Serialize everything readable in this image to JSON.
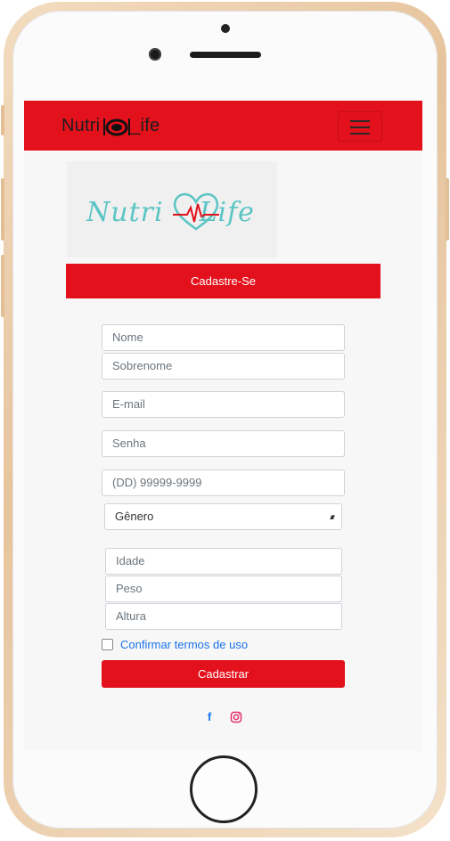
{
  "navbar": {
    "brand_left": "Nutri",
    "brand_right": "_ife",
    "menu_icon": "hamburger-icon",
    "color": "#e3111c"
  },
  "logo": {
    "part1": "Nutri",
    "part2": "Life",
    "color": "#5bc5c4"
  },
  "page_title": "Cadastre-Se",
  "form": {
    "nome_placeholder": "Nome",
    "sobrenome_placeholder": "Sobrenome",
    "email_placeholder": "E-mail",
    "senha_placeholder": "Senha",
    "telefone_placeholder": "(DD) 99999-9999",
    "genero_selected": "Gênero",
    "idade_placeholder": "Idade",
    "peso_placeholder": "Peso",
    "altura_placeholder": "Altura",
    "terms_label": "Confirmar termos de uso",
    "terms_checked": false,
    "submit_label": "Cadastrar"
  },
  "social": {
    "facebook_icon": "facebook-icon",
    "facebook_glyph": "f",
    "facebook_color": "#1877f2",
    "instagram_icon": "instagram-icon",
    "instagram_color": "#e1306c"
  }
}
